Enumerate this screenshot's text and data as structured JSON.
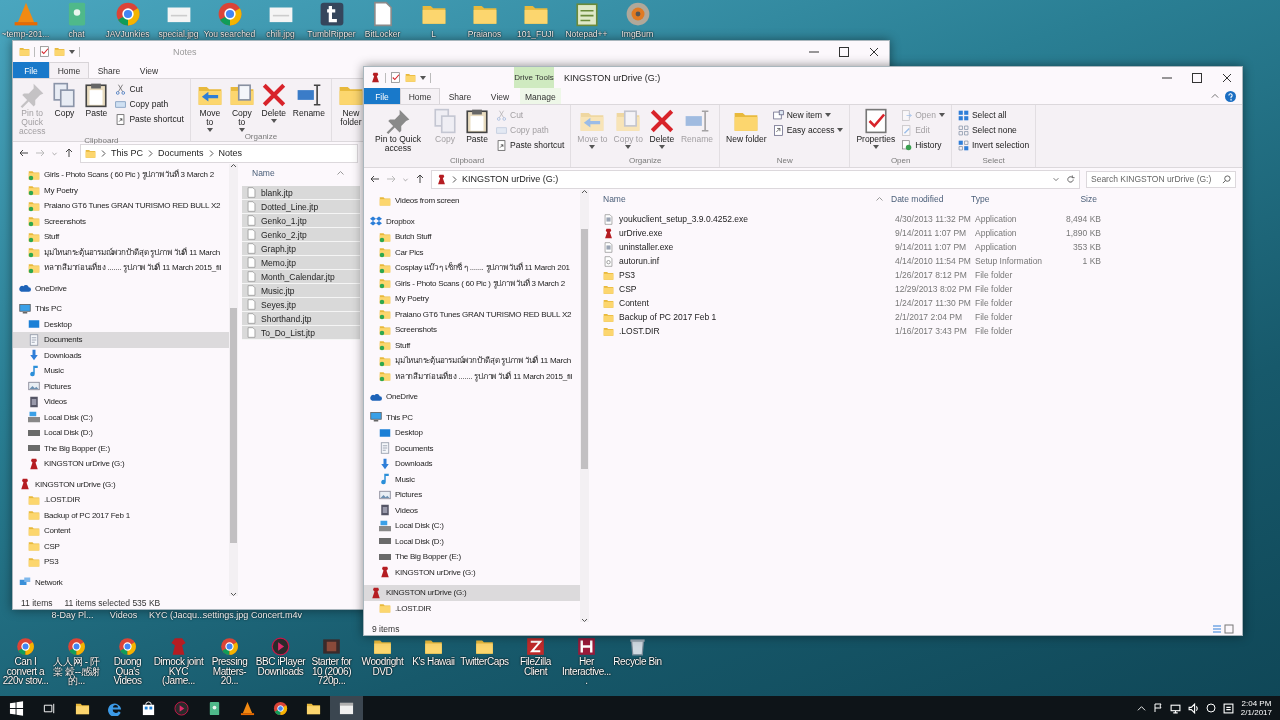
{
  "desktop": {
    "top_icons": [
      {
        "label": "~temp-201...",
        "kind": "vlc"
      },
      {
        "label": "chat",
        "kind": "app"
      },
      {
        "label": "JAVJunkies",
        "kind": "chrome"
      },
      {
        "label": "special.jpg",
        "kind": "image"
      },
      {
        "label": "You searched",
        "kind": "chrome"
      },
      {
        "label": "chili.jpg",
        "kind": "image"
      },
      {
        "label": "TumblRipper",
        "kind": "tumblr"
      },
      {
        "label": "BitLocker",
        "kind": "file"
      },
      {
        "label": "L",
        "kind": "folder"
      },
      {
        "label": "Praianos",
        "kind": "folder"
      },
      {
        "label": "101_FUJI",
        "kind": "folder"
      },
      {
        "label": "Notepad++",
        "kind": "notepad"
      },
      {
        "label": "ImgBurn",
        "kind": "disc"
      }
    ],
    "covered_labels": [
      "8-Day Pl...",
      "Videos",
      "KYC (Jacqu...",
      "settings.jpg",
      "Concert.m4v"
    ],
    "bottom_icons": [
      {
        "label": "Can I convert a 220v stov...",
        "kind": "chrome"
      },
      {
        "label": "人人网 - 阡棠 穀--感谢的...",
        "kind": "chrome"
      },
      {
        "label": "Duong Qua's Videos",
        "kind": "chrome"
      },
      {
        "label": "Dimock joint KYC (Jame...",
        "kind": "figure"
      },
      {
        "label": "Pressing Matters- 20...",
        "kind": "chrome"
      },
      {
        "label": "BBC iPlayer Downloads",
        "kind": "media"
      },
      {
        "label": "Starter for 10 (2006) 720p...",
        "kind": "film"
      },
      {
        "label": "Woodright DVD",
        "kind": "folder"
      },
      {
        "label": "K's Hawaii",
        "kind": "folder"
      },
      {
        "label": "TwitterCaps",
        "kind": "folder"
      },
      {
        "label": "FileZilla Client",
        "kind": "filezilla"
      },
      {
        "label": "Her Interactive....",
        "kind": "her"
      },
      {
        "label": "Recycle Bin",
        "kind": "recycle"
      }
    ]
  },
  "notes_window": {
    "title": "Notes",
    "active": false,
    "tabs": [
      {
        "label": "File",
        "kind": "menu",
        "selected": false
      },
      {
        "label": "Home",
        "kind": "tab",
        "selected": true
      },
      {
        "label": "Share",
        "kind": "tab",
        "selected": false
      },
      {
        "label": "View",
        "kind": "tab",
        "selected": false
      }
    ],
    "ribbon": [
      {
        "label": "Clipboard",
        "large_buttons": [
          {
            "label": "Pin to Quick access",
            "kind": "pin",
            "disabled": true,
            "dropdown": false
          },
          {
            "label": "Copy",
            "kind": "copy",
            "disabled": false,
            "dropdown": false
          },
          {
            "label": "Paste",
            "kind": "paste",
            "disabled": false,
            "dropdown": false
          }
        ],
        "small_buttons": [
          {
            "label": "Cut",
            "kind": "cut",
            "disabled": false,
            "dropdown": false
          },
          {
            "label": "Copy path",
            "kind": "copypath",
            "disabled": false,
            "dropdown": false
          },
          {
            "label": "Paste shortcut",
            "kind": "shortcut",
            "disabled": false,
            "dropdown": false
          }
        ]
      },
      {
        "label": "Organize",
        "large_buttons": [
          {
            "label": "Move to",
            "kind": "move",
            "disabled": false,
            "dropdown": true
          },
          {
            "label": "Copy to",
            "kind": "copyto",
            "disabled": false,
            "dropdown": true
          },
          {
            "label": "Delete",
            "kind": "delete",
            "disabled": false,
            "dropdown": true
          },
          {
            "label": "Rename",
            "kind": "rename",
            "disabled": false,
            "dropdown": false
          }
        ]
      },
      {
        "large_buttons": [
          {
            "label": "New folder",
            "kind": "newfolder",
            "disabled": false,
            "dropdown": false
          }
        ]
      }
    ],
    "address": {
      "kind": "folder",
      "crumbs": [
        "This PC",
        "Documents",
        "Notes"
      ]
    },
    "nav": [
      {
        "children": [
          {
            "label": "Girls - Photo Scans ( 60 Pic ) รูปภาพ วันที่ 3 March 2",
            "kind": "sync",
            "selected": false
          },
          {
            "label": "My Poetry",
            "kind": "sync",
            "selected": false
          },
          {
            "label": "Praiano GT6 Tunes GRAN TURISMO RED BULL X2",
            "kind": "sync",
            "selected": false
          },
          {
            "label": "Screenshots",
            "kind": "sync",
            "selected": false
          },
          {
            "label": "Stuff",
            "kind": "sync",
            "selected": false
          },
          {
            "label": "มุมไหนกระตุ้นอารมณ์พวกป้าดีสุด รูปภาพ วันที่ 11 March",
            "kind": "sync",
            "selected": false
          },
          {
            "label": "หลากสีมาก่อนเที่ยง ....... รูปภาพ วันที่ 11 March 2015_fil",
            "kind": "sync",
            "selected": false
          }
        ]
      },
      {
        "label": "OneDrive",
        "kind": "onedrive",
        "selected": false
      },
      {
        "label": "This PC",
        "kind": "pc",
        "selected": false,
        "children": [
          {
            "label": "Desktop",
            "kind": "desktop",
            "selected": false
          },
          {
            "label": "Documents",
            "kind": "documents",
            "selected": true
          },
          {
            "label": "Downloads",
            "kind": "downloads",
            "selected": false
          },
          {
            "label": "Music",
            "kind": "music",
            "selected": false
          },
          {
            "label": "Pictures",
            "kind": "pictures",
            "selected": false
          },
          {
            "label": "Videos",
            "kind": "videos",
            "selected": false
          },
          {
            "label": "Local Disk (C:)",
            "kind": "disk",
            "selected": false
          },
          {
            "label": "Local Disk (D:)",
            "kind": "drive",
            "selected": false
          },
          {
            "label": "The Big Bopper (E:)",
            "kind": "drive",
            "selected": false
          },
          {
            "label": "KINGSTON urDrive (G:)",
            "kind": "kingston",
            "selected": false
          }
        ]
      },
      {
        "label": "KINGSTON urDrive (G:)",
        "kind": "kingston",
        "selected": false,
        "children": [
          {
            "label": ".LOST.DIR",
            "kind": "folder",
            "selected": false
          },
          {
            "label": "Backup of PC 2017 Feb 1",
            "kind": "folder",
            "selected": false
          },
          {
            "label": "Content",
            "kind": "folder",
            "selected": false
          },
          {
            "label": "CSP",
            "kind": "folder",
            "selected": false
          },
          {
            "label": "PS3",
            "kind": "folder",
            "selected": false
          }
        ]
      },
      {
        "label": "Network",
        "kind": "network",
        "selected": false
      }
    ],
    "columns": [
      {
        "label": "Name"
      }
    ],
    "files": [
      {
        "name": "blank.jtp",
        "kind": "file",
        "selected": true
      },
      {
        "name": "Dotted_Line.jtp",
        "kind": "file",
        "selected": true
      },
      {
        "name": "Genko_1.jtp",
        "kind": "file",
        "selected": true
      },
      {
        "name": "Genko_2.jtp",
        "kind": "file",
        "selected": true
      },
      {
        "name": "Graph.jtp",
        "kind": "file",
        "selected": true
      },
      {
        "name": "Memo.jtp",
        "kind": "file",
        "selected": true
      },
      {
        "name": "Month_Calendar.jtp",
        "kind": "file",
        "selected": true
      },
      {
        "name": "Music.jtp",
        "kind": "file",
        "selected": true
      },
      {
        "name": "Seyes.jtp",
        "kind": "file",
        "selected": true
      },
      {
        "name": "Shorthand.jtp",
        "kind": "file",
        "selected": true
      },
      {
        "name": "To_Do_List.jtp",
        "kind": "file",
        "selected": true
      }
    ],
    "status": [
      "11 items",
      "11 items selected  535 KB"
    ]
  },
  "drive_window": {
    "title": "KINGSTON urDrive (G:)",
    "context_label": "Drive Tools",
    "active": true,
    "tabs": [
      {
        "label": "File",
        "kind": "menu",
        "selected": false
      },
      {
        "label": "Home",
        "kind": "tab",
        "selected": true
      },
      {
        "label": "Share",
        "kind": "tab",
        "selected": false
      },
      {
        "label": "View",
        "kind": "tab",
        "selected": false
      },
      {
        "label": "Manage",
        "kind": "context",
        "selected": false
      }
    ],
    "ribbon": [
      {
        "label": "Clipboard",
        "large_buttons": [
          {
            "label": "Pin to Quick access",
            "kind": "pin",
            "disabled": false,
            "dropdown": false
          },
          {
            "label": "Copy",
            "kind": "copy",
            "disabled": true,
            "dropdown": false
          },
          {
            "label": "Paste",
            "kind": "paste",
            "disabled": false,
            "dropdown": false
          }
        ],
        "small_buttons": [
          {
            "label": "Cut",
            "kind": "cut",
            "disabled": true,
            "dropdown": false
          },
          {
            "label": "Copy path",
            "kind": "copypath",
            "disabled": true,
            "dropdown": false
          },
          {
            "label": "Paste shortcut",
            "kind": "shortcut",
            "disabled": false,
            "dropdown": false
          }
        ]
      },
      {
        "label": "Organize",
        "large_buttons": [
          {
            "label": "Move to",
            "kind": "move",
            "disabled": true,
            "dropdown": true
          },
          {
            "label": "Copy to",
            "kind": "copyto",
            "disabled": true,
            "dropdown": true
          },
          {
            "label": "Delete",
            "kind": "delete",
            "disabled": false,
            "dropdown": true
          },
          {
            "label": "Rename",
            "kind": "rename",
            "disabled": true,
            "dropdown": false
          }
        ]
      },
      {
        "label": "New",
        "large_buttons": [
          {
            "label": "New folder",
            "kind": "newfolder",
            "disabled": false,
            "dropdown": false
          }
        ],
        "small_buttons": [
          {
            "label": "New item",
            "kind": "newitem",
            "disabled": false,
            "dropdown": true
          },
          {
            "label": "Easy access",
            "kind": "easyaccess",
            "disabled": false,
            "dropdown": true
          }
        ]
      },
      {
        "label": "Open",
        "large_buttons": [
          {
            "label": "Properties",
            "kind": "properties",
            "disabled": false,
            "dropdown": true
          }
        ],
        "small_buttons": [
          {
            "label": "Open",
            "kind": "open",
            "disabled": true,
            "dropdown": true
          },
          {
            "label": "Edit",
            "kind": "edit",
            "disabled": true,
            "dropdown": false
          },
          {
            "label": "History",
            "kind": "history",
            "disabled": false,
            "dropdown": false
          }
        ]
      },
      {
        "label": "Select",
        "small_buttons": [
          {
            "label": "Select all",
            "kind": "selectall",
            "disabled": false,
            "dropdown": false
          },
          {
            "label": "Select none",
            "kind": "selectnone",
            "disabled": false,
            "dropdown": false
          },
          {
            "label": "Invert selection",
            "kind": "invert",
            "disabled": false,
            "dropdown": false
          }
        ]
      }
    ],
    "address": {
      "kind": "kingston",
      "crumbs": [
        "KINGSTON urDrive (G:)"
      ]
    },
    "search": {
      "placeholder": "Search KINGSTON urDrive (G:)"
    },
    "nav": [
      {
        "children": [
          {
            "label": "Videos from screen",
            "kind": "folder",
            "selected": false
          }
        ]
      },
      {
        "label": "Dropbox",
        "kind": "dropbox",
        "selected": false,
        "children": [
          {
            "label": "Butch Stuff",
            "kind": "sync",
            "selected": false
          },
          {
            "label": "Car Pics",
            "kind": "sync",
            "selected": false
          },
          {
            "label": "Cosplay แบ๊ว ๆ เซ็กซี่ ๆ ....... รูปภาพ วันที่ 11 March 201",
            "kind": "sync",
            "selected": false
          },
          {
            "label": "Girls - Photo Scans ( 60 Pic ) รูปภาพ วันที่ 3 March 2",
            "kind": "sync",
            "selected": false
          },
          {
            "label": "My Poetry",
            "kind": "sync",
            "selected": false
          },
          {
            "label": "Praiano GT6 Tunes GRAN TURISMO RED BULL X2",
            "kind": "sync",
            "selected": false
          },
          {
            "label": "Screenshots",
            "kind": "sync",
            "selected": false
          },
          {
            "label": "Stuff",
            "kind": "sync",
            "selected": false
          },
          {
            "label": "มุมไหนกระตุ้นอารมณ์พวกป้าดีสุด รูปภาพ วันที่ 11 March",
            "kind": "sync",
            "selected": false
          },
          {
            "label": "หลากสีมาก่อนเที่ยง ....... รูปภาพ วันที่ 11 March 2015_fil",
            "kind": "sync",
            "selected": false
          }
        ]
      },
      {
        "label": "OneDrive",
        "kind": "onedrive",
        "selected": false
      },
      {
        "label": "This PC",
        "kind": "pc",
        "selected": false,
        "children": [
          {
            "label": "Desktop",
            "kind": "desktop",
            "selected": false
          },
          {
            "label": "Documents",
            "kind": "documents",
            "selected": false
          },
          {
            "label": "Downloads",
            "kind": "downloads",
            "selected": false
          },
          {
            "label": "Music",
            "kind": "music",
            "selected": false
          },
          {
            "label": "Pictures",
            "kind": "pictures",
            "selected": false
          },
          {
            "label": "Videos",
            "kind": "videos",
            "selected": false
          },
          {
            "label": "Local Disk (C:)",
            "kind": "disk",
            "selected": false
          },
          {
            "label": "Local Disk (D:)",
            "kind": "drive",
            "selected": false
          },
          {
            "label": "The Big Bopper (E:)",
            "kind": "drive",
            "selected": false
          },
          {
            "label": "KINGSTON urDrive (G:)",
            "kind": "kingston",
            "selected": false
          }
        ]
      },
      {
        "label": "KINGSTON urDrive (G:)",
        "kind": "kingston",
        "selected": true,
        "children": [
          {
            "label": ".LOST.DIR",
            "kind": "folder",
            "selected": false
          }
        ]
      }
    ],
    "columns": [
      {
        "label": "Name"
      },
      {
        "label": "Date modified"
      },
      {
        "label": "Type"
      },
      {
        "label": "Size"
      }
    ],
    "files": [
      {
        "name": "youkuclient_setup_3.9.0.4252.exe",
        "kind": "exe",
        "date_modified": "4/30/2013 11:32 PM",
        "type": "Application",
        "size": "8,494 KB",
        "selected": false
      },
      {
        "name": "urDrive.exe",
        "kind": "kingston",
        "date_modified": "9/14/2011 1:07 PM",
        "type": "Application",
        "size": "1,890 KB",
        "selected": false
      },
      {
        "name": "uninstaller.exe",
        "kind": "exe",
        "date_modified": "9/14/2011 1:07 PM",
        "type": "Application",
        "size": "353 KB",
        "selected": false
      },
      {
        "name": "autorun.inf",
        "kind": "inf",
        "date_modified": "4/14/2010 11:54 PM",
        "type": "Setup Information",
        "size": "1 KB",
        "selected": false
      },
      {
        "name": "PS3",
        "kind": "folder",
        "date_modified": "1/26/2017 8:12 PM",
        "type": "File folder",
        "selected": false
      },
      {
        "name": "CSP",
        "kind": "folder",
        "date_modified": "12/29/2013 8:02 PM",
        "type": "File folder",
        "selected": false
      },
      {
        "name": "Content",
        "kind": "folder",
        "date_modified": "1/24/2017 11:30 PM",
        "type": "File folder",
        "selected": false
      },
      {
        "name": "Backup of PC 2017 Feb 1",
        "kind": "folder",
        "date_modified": "2/1/2017 2:04 PM",
        "type": "File folder",
        "selected": false
      },
      {
        "name": ".LOST.DIR",
        "kind": "folder",
        "date_modified": "1/16/2017 3:43 PM",
        "type": "File folder",
        "selected": false
      }
    ],
    "status": [
      "9 items"
    ]
  },
  "taskbar": {
    "apps": [
      {
        "kind": "start",
        "selected": false
      },
      {
        "kind": "taskview",
        "selected": false
      },
      {
        "kind": "folder",
        "selected": false
      },
      {
        "kind": "edge",
        "selected": false
      },
      {
        "kind": "store",
        "selected": false
      },
      {
        "kind": "media",
        "selected": false
      },
      {
        "kind": "app",
        "selected": false
      },
      {
        "kind": "vlc",
        "selected": false
      },
      {
        "kind": "chrome",
        "selected": false
      },
      {
        "kind": "folder",
        "selected": false
      },
      {
        "kind": "notes",
        "selected": true
      }
    ],
    "time": "2:04 PM",
    "date": "2/1/2017"
  }
}
